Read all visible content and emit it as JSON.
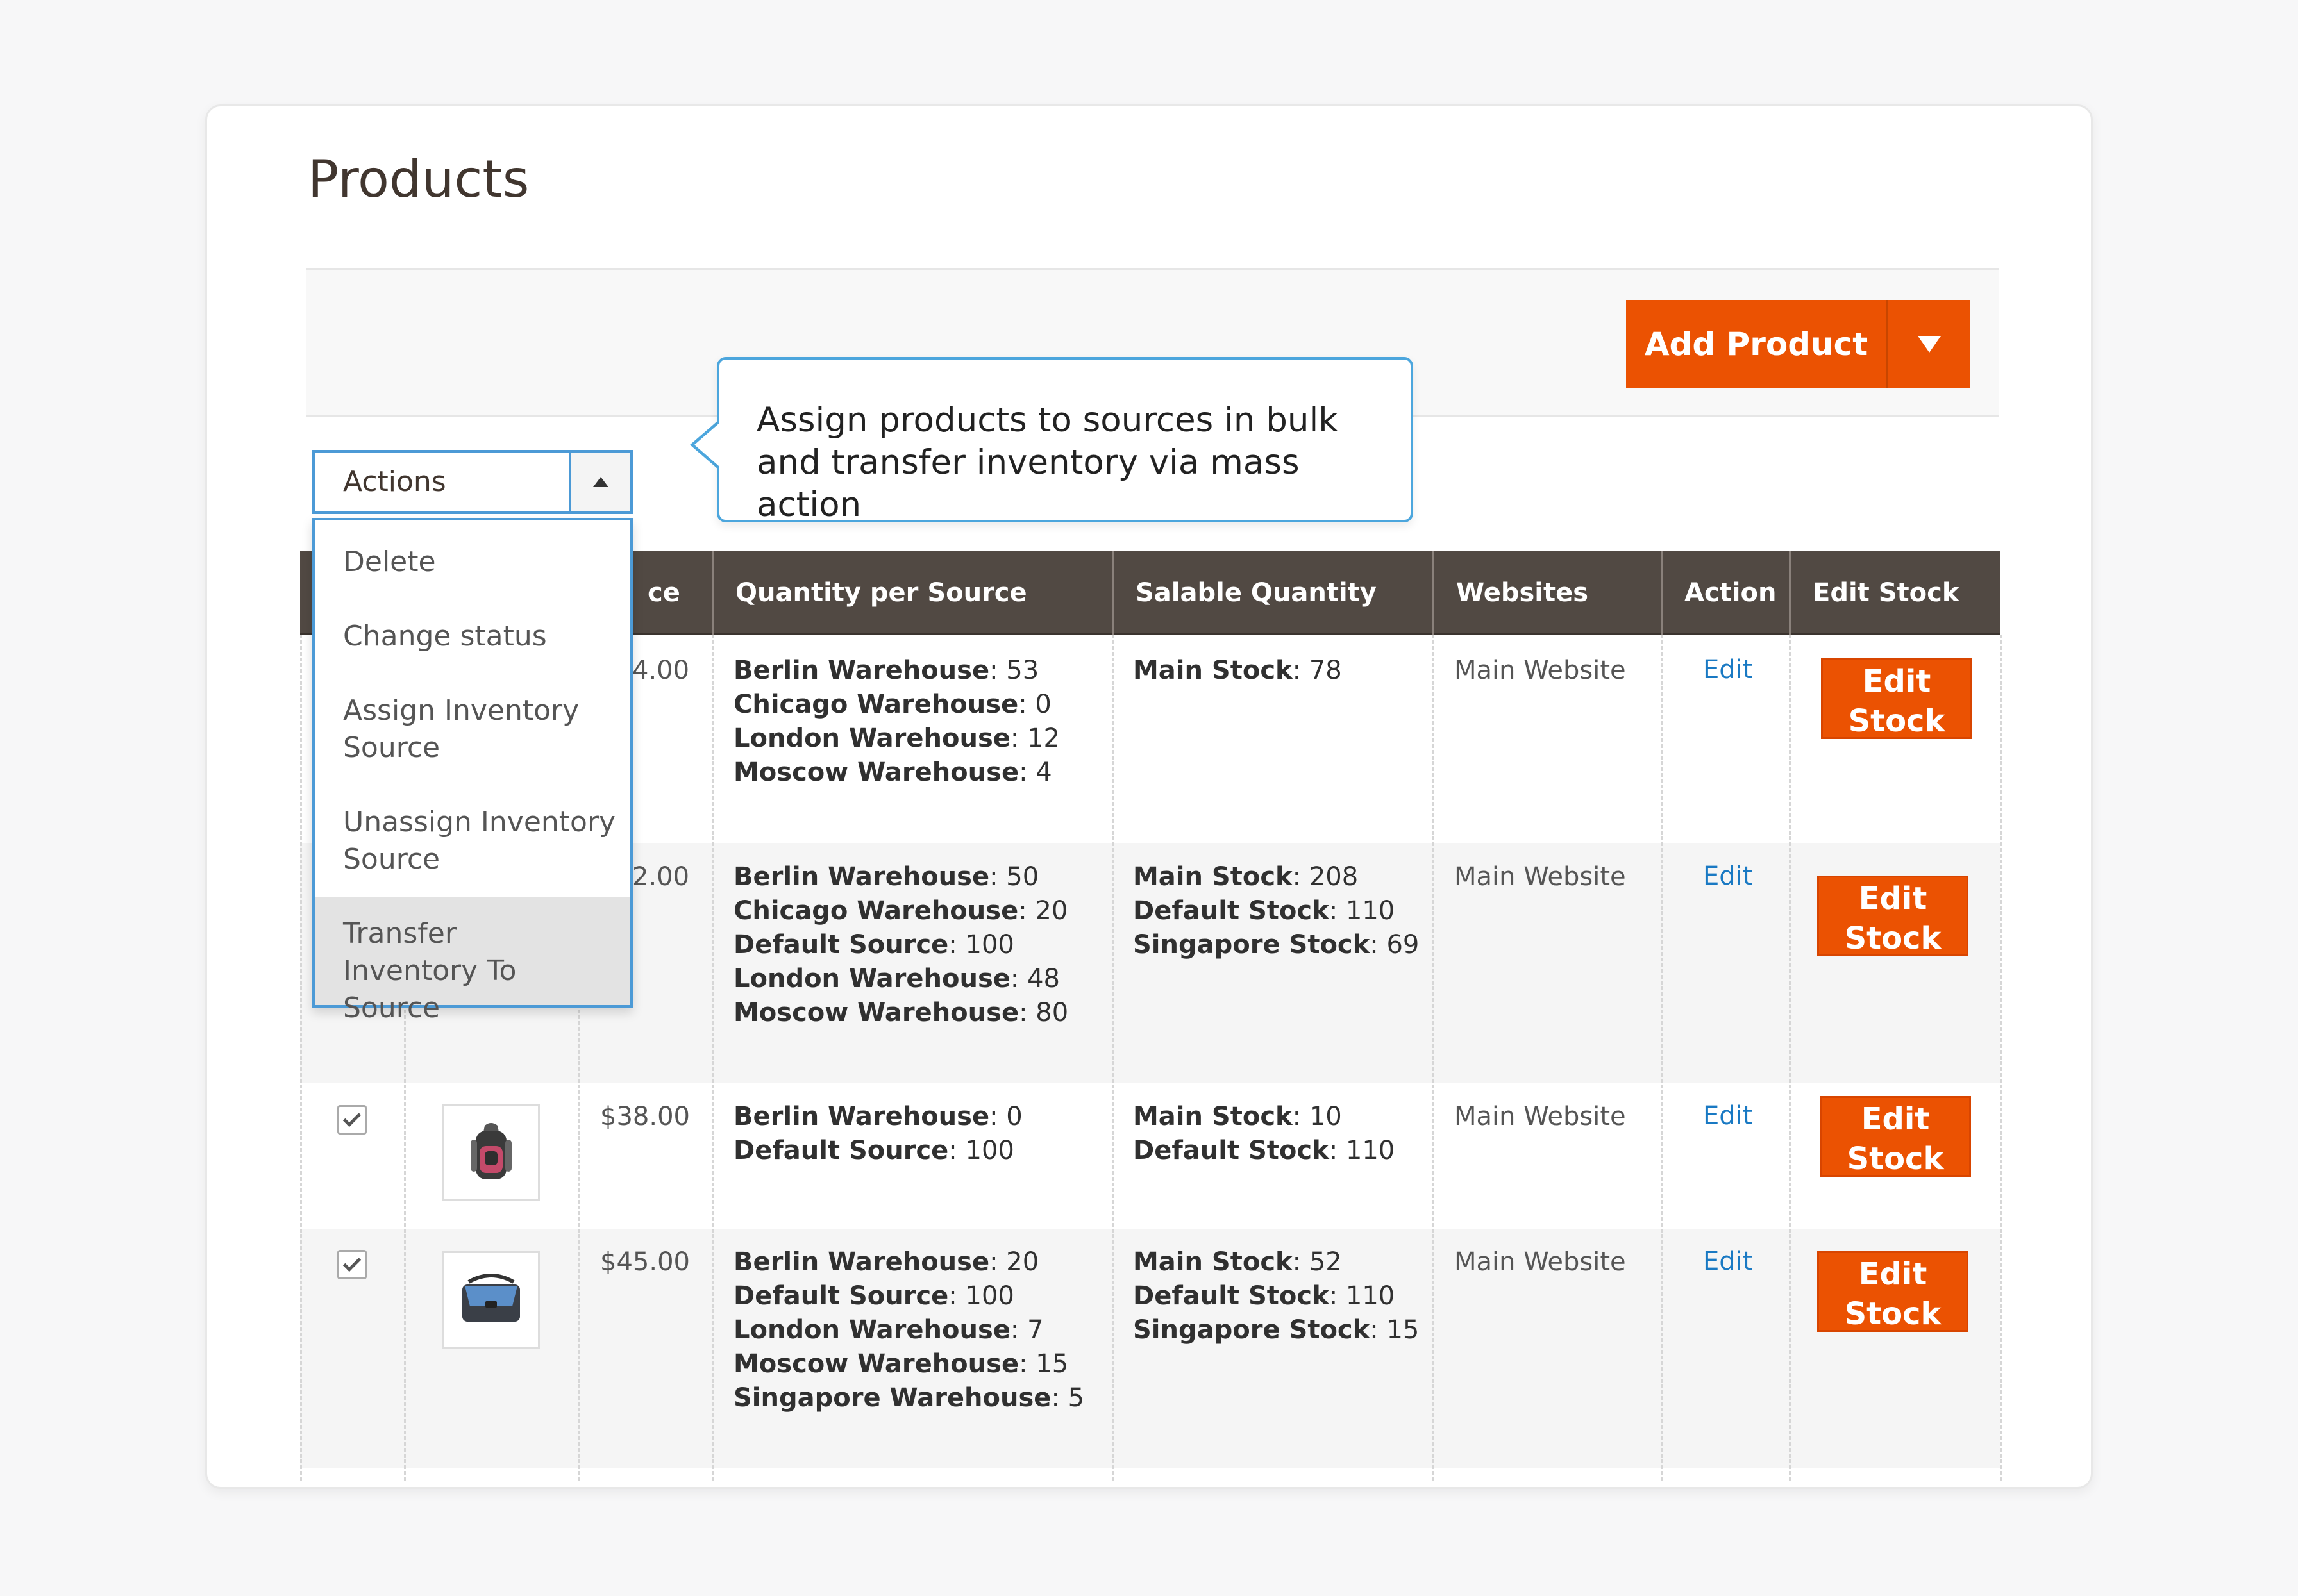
{
  "page": {
    "title": "Products"
  },
  "toolbar": {
    "add_product_label": "Add Product"
  },
  "callout": {
    "text": "Assign products to sources in bulk and transfer inventory via mass action"
  },
  "actions": {
    "value": "Actions",
    "items": [
      "Delete",
      "Change status",
      "Assign Inventory Source",
      "Unassign Inventory Source",
      "Transfer Inventory To Source"
    ]
  },
  "grid": {
    "columns": {
      "price_partial": "ce",
      "qty_per_source": "Quantity per Source",
      "salable": "Salable Quantity",
      "websites": "Websites",
      "action": "Action",
      "edit_stock": "Edit Stock"
    },
    "rows": [
      {
        "price": "4.00",
        "sources": [
          [
            "Berlin Warehouse",
            "53"
          ],
          [
            "Chicago Warehouse",
            "0"
          ],
          [
            "London Warehouse",
            "12"
          ],
          [
            "Moscow Warehouse",
            "4"
          ]
        ],
        "salable": [
          [
            "Main Stock",
            "78"
          ]
        ],
        "website": "Main Website",
        "action": "Edit",
        "edit_stock": "Edit Stock"
      },
      {
        "price": "2.00",
        "sources": [
          [
            "Berlin Warehouse",
            "50"
          ],
          [
            "Chicago Warehouse",
            "20"
          ],
          [
            "Default Source",
            "100"
          ],
          [
            "London Warehouse",
            "48"
          ],
          [
            "Moscow Warehouse",
            "80"
          ]
        ],
        "salable": [
          [
            "Main Stock",
            "208"
          ],
          [
            "Default Stock",
            "110"
          ],
          [
            "Singapore Stock",
            "69"
          ]
        ],
        "website": "Main Website",
        "action": "Edit",
        "edit_stock": "Edit Stock"
      },
      {
        "price": "$38.00",
        "sources": [
          [
            "Berlin Warehouse",
            "0"
          ],
          [
            "Default Source",
            "100"
          ]
        ],
        "salable": [
          [
            "Main Stock",
            "10"
          ],
          [
            "Default Stock",
            "110"
          ]
        ],
        "website": "Main Website",
        "action": "Edit",
        "edit_stock": "Edit Stock",
        "thumb": "backpack-thumbnail"
      },
      {
        "price": "$45.00",
        "sources": [
          [
            "Berlin Warehouse",
            "20"
          ],
          [
            "Default Source",
            "100"
          ],
          [
            "London Warehouse",
            "7"
          ],
          [
            "Moscow Warehouse",
            "15"
          ],
          [
            "Singapore Warehouse",
            "5"
          ]
        ],
        "salable": [
          [
            "Main Stock",
            "52"
          ],
          [
            "Default Stock",
            "110"
          ],
          [
            "Singapore Stock",
            "15"
          ]
        ],
        "website": "Main Website",
        "action": "Edit",
        "edit_stock": "Edit Stock",
        "thumb": "messenger-bag-thumbnail"
      }
    ]
  },
  "colors": {
    "accent": "#eb5202",
    "header_bg": "#514943",
    "link": "#1979c3",
    "focus": "#4c9ad6"
  }
}
